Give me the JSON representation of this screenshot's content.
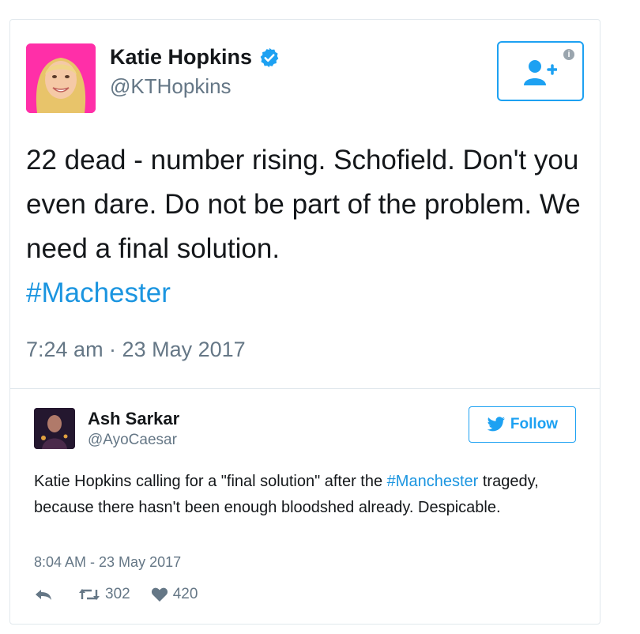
{
  "tweet": {
    "author_name": "Katie Hopkins",
    "author_handle": "@KTHopkins",
    "text_before": "22 dead - number rising. Schofield. Don't you even dare. Do not be part of the problem. We need a final solution.",
    "hashtag": "#Machester",
    "timestamp": "7:24 am · 23 May 2017"
  },
  "quoted": {
    "author_name": "Ash Sarkar",
    "author_handle": "@AyoCaesar",
    "follow_label": "Follow",
    "text_before": "Katie Hopkins calling for a \"final solution\" after the ",
    "hashtag": "#Manchester",
    "text_after": " tragedy, because there hasn't been enough bloodshed already. Despicable.",
    "timestamp": "8:04 AM - 23 May 2017",
    "retweets": "302",
    "likes": "420"
  },
  "colors": {
    "accent": "#1da1f2",
    "hashtag": "#1b95e0",
    "muted": "#657786",
    "avatar_bg": "#ff2fa8"
  },
  "icons": {
    "verified": "verified-badge-icon",
    "follow": "add-user-icon",
    "info": "info-icon",
    "bird": "twitter-bird-icon",
    "reply": "reply-icon",
    "retweet": "retweet-icon",
    "like": "heart-icon"
  }
}
